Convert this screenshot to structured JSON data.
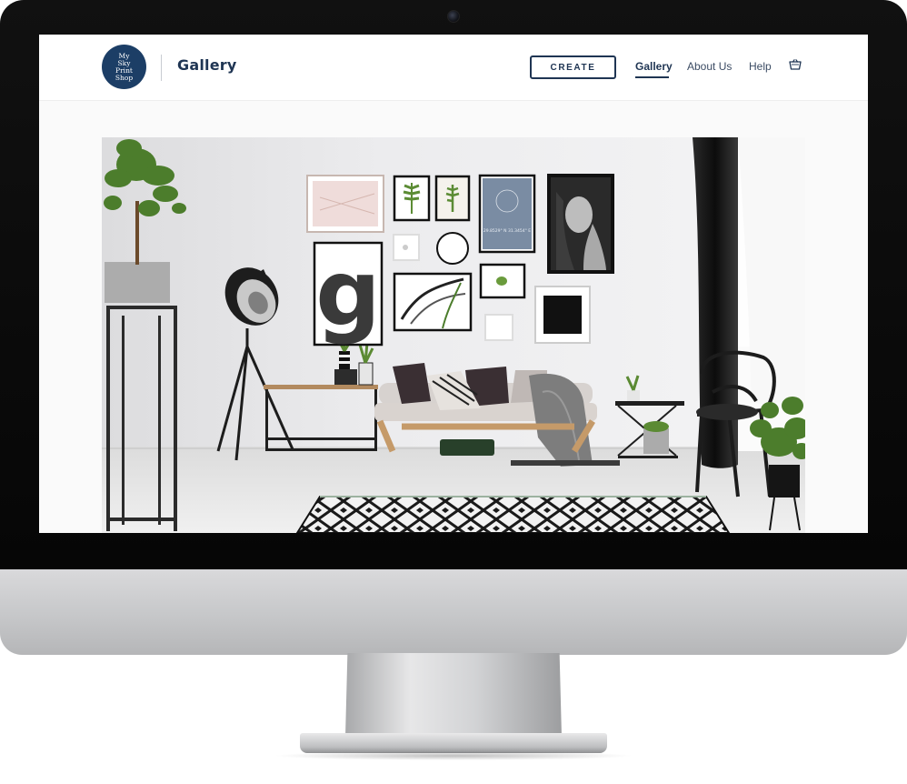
{
  "brand": {
    "logo_text": "My\nSky\nPrint\nShop",
    "color": "#1c3e66"
  },
  "header": {
    "page_title": "Gallery",
    "create_button": "CREATE",
    "nav": [
      {
        "label": "Gallery",
        "active": true
      },
      {
        "label": "About Us",
        "active": false
      },
      {
        "label": "Help",
        "active": false
      }
    ],
    "cart_icon": "cart-icon"
  },
  "hero": {
    "image": "living-room-gallery-wall-photo",
    "poster_letter": "g",
    "poster_caption": "29.8529° N 31.3454° E"
  },
  "colors": {
    "navy": "#1f3553",
    "nav_text": "#3c4c64",
    "header_bg": "#ffffff",
    "page_bg": "#fafafa"
  }
}
